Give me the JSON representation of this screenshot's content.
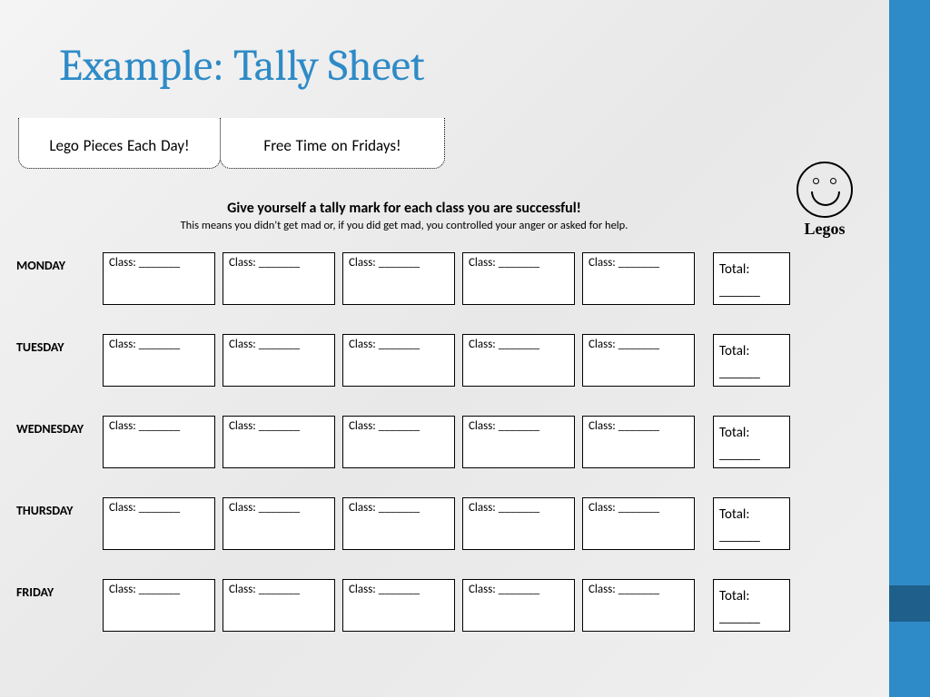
{
  "title": "Example: Tally Sheet",
  "rewards": {
    "left": "Lego Pieces Each Day! ",
    "right": "Free Time on Fridays! "
  },
  "instruction": {
    "bold": "Give yourself a tally mark for each class you are successful!  ",
    "sub": "This means you didn't get mad or, if you did get mad, you controlled your anger or asked for help. "
  },
  "smiley_label": "Legos",
  "days": [
    "MONDAY ",
    "TUESDAY ",
    "WEDNESDAY ",
    "THURSDAY ",
    "FRIDAY "
  ],
  "class_label": "Class: _______ ",
  "total_label": "Total: ",
  "total_line": "______ ",
  "classes_per_day": 5
}
